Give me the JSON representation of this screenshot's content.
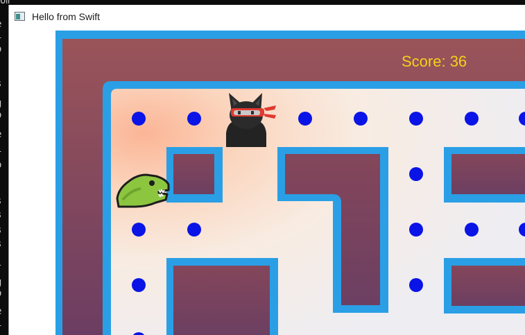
{
  "terminal": {
    "top_text": "ompiling Colo main.swift",
    "left_chars": [
      "e",
      "i",
      "o",
      "s",
      "g",
      "o",
      "e",
      "i",
      "o",
      "s",
      "s",
      "s",
      "s",
      "l",
      "g",
      "o",
      "e",
      "i"
    ]
  },
  "window": {
    "title": "Hello from Swift"
  },
  "game": {
    "score_text": "Score: 36",
    "player_icon": "dinosaur-icon",
    "enemy_icon": "ninja-cat-icon",
    "pellet_color": "#0a14e6",
    "wall_color": "#2a9fe6",
    "wall_fill_color": "#7a4260"
  }
}
